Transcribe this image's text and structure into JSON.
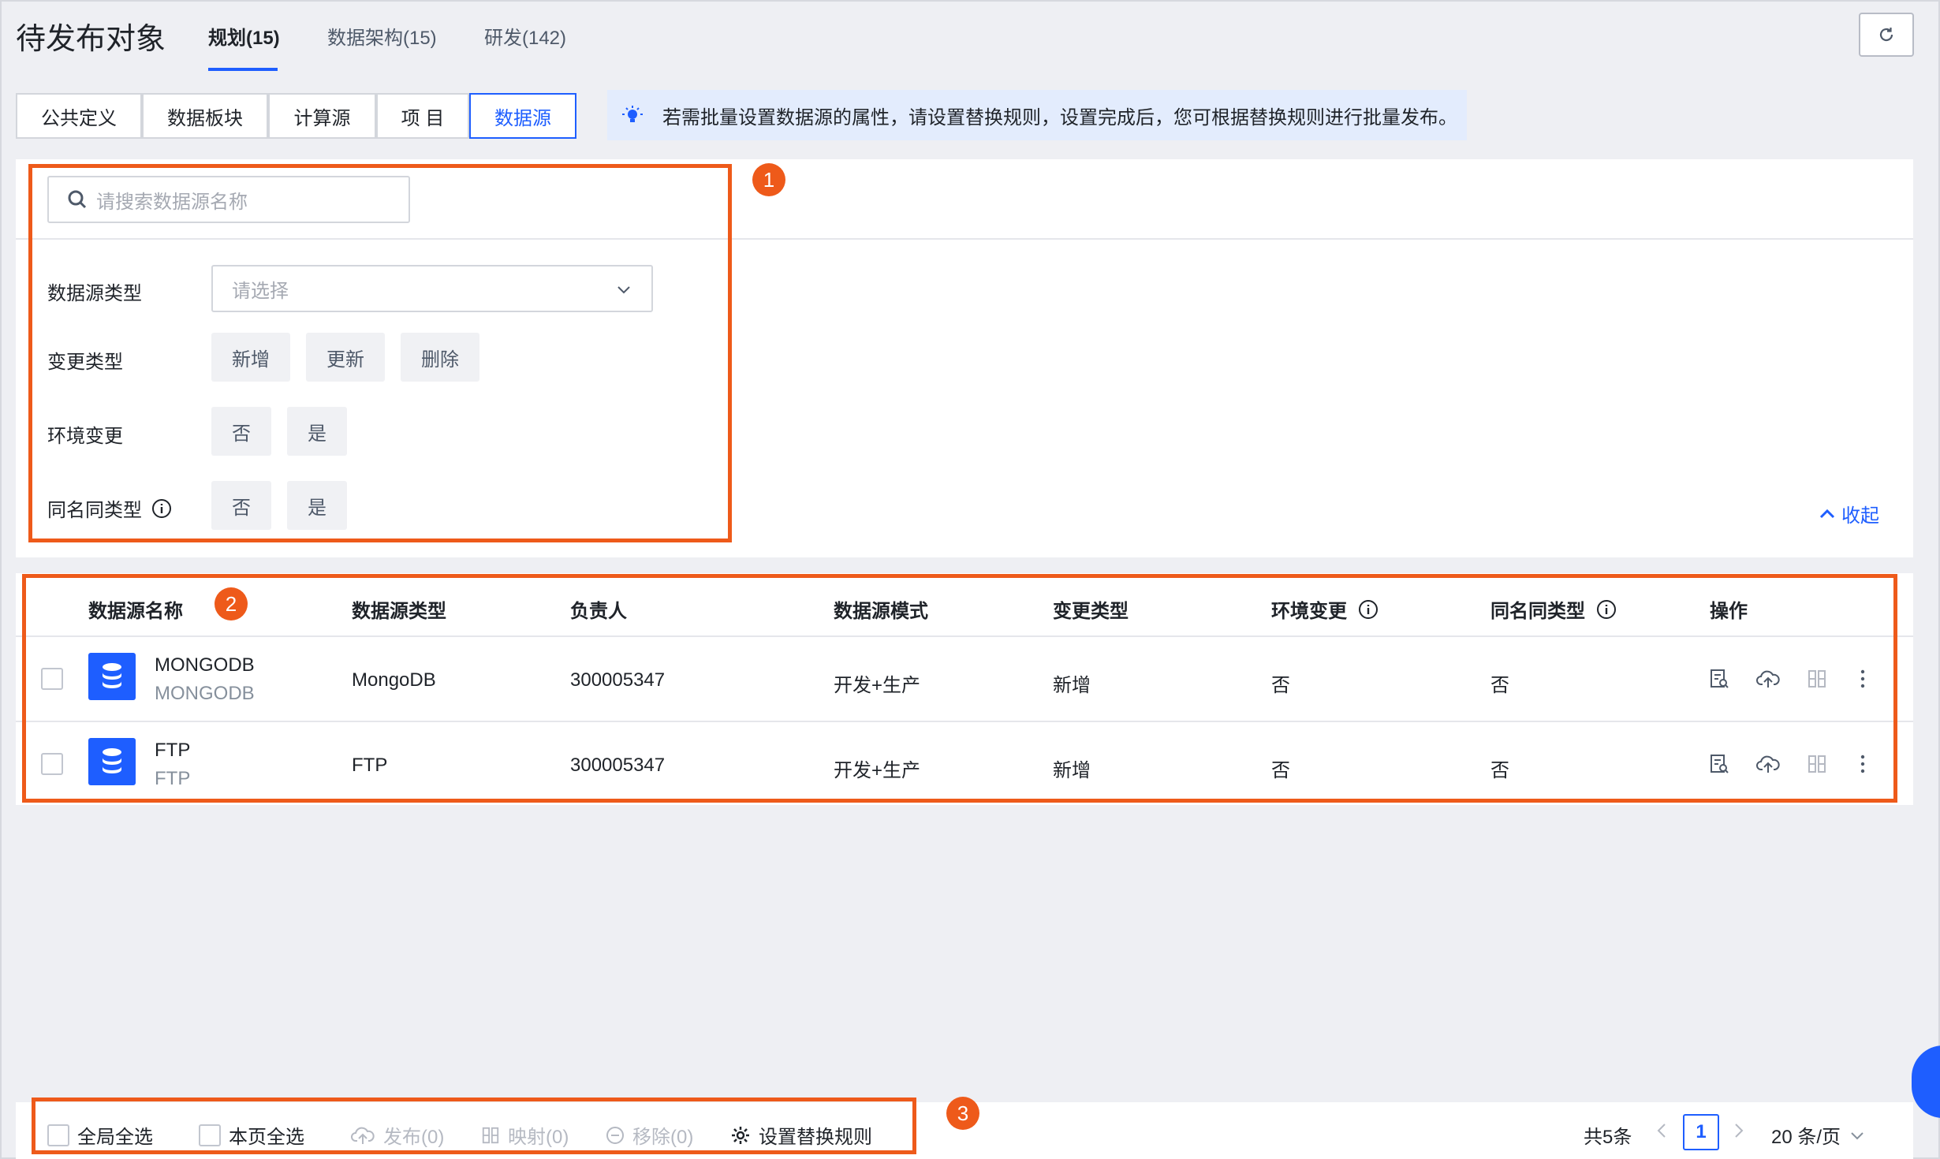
{
  "header": {
    "title": "待发布对象",
    "tabs": [
      {
        "label": "规划(15)",
        "active": true
      },
      {
        "label": "数据架构(15)",
        "active": false
      },
      {
        "label": "研发(142)",
        "active": false
      }
    ],
    "refresh_icon": "refresh-icon"
  },
  "subtabs": [
    {
      "label": "公共定义",
      "active": false
    },
    {
      "label": "数据板块",
      "active": false
    },
    {
      "label": "计算源",
      "active": false
    },
    {
      "label": "项 目",
      "active": false
    },
    {
      "label": "数据源",
      "active": true
    }
  ],
  "tip": {
    "icon": "lightbulb-icon",
    "text": "若需批量设置数据源的属性，请设置替换规则，设置完成后，您可根据替换规则进行批量发布。"
  },
  "filters": {
    "search_placeholder": "请搜索数据源名称",
    "type_label": "数据源类型",
    "type_placeholder": "请选择",
    "change_label": "变更类型",
    "change_options": [
      "新增",
      "更新",
      "删除"
    ],
    "env_label": "环境变更",
    "env_options": [
      "否",
      "是"
    ],
    "same_label": "同名同类型",
    "same_options": [
      "否",
      "是"
    ],
    "collapse_label": "收起"
  },
  "callouts": [
    "1",
    "2",
    "3"
  ],
  "table": {
    "columns": [
      "数据源名称",
      "数据源类型",
      "负责人",
      "数据源模式",
      "变更类型",
      "环境变更",
      "同名同类型",
      "操作"
    ],
    "rows": [
      {
        "name": "MONGODB",
        "sub": "MONGODB",
        "type": "MongoDB",
        "owner": "300005347",
        "mode": "开发+生产",
        "change": "新增",
        "env": "否",
        "same": "否"
      },
      {
        "name": "FTP",
        "sub": "FTP",
        "type": "FTP",
        "owner": "300005347",
        "mode": "开发+生产",
        "change": "新增",
        "env": "否",
        "same": "否"
      }
    ],
    "op_icons": [
      "detail-icon",
      "cloud-upload-icon",
      "mapping-icon",
      "more-icon"
    ]
  },
  "footer": {
    "select_all_global": "全局全选",
    "select_all_page": "本页全选",
    "publish": "发布(0)",
    "map": "映射(0)",
    "remove": "移除(0)",
    "rules": "设置替换规则",
    "total": "共5条",
    "current_page": "1",
    "page_size": "20 条/页"
  },
  "colors": {
    "accent": "#1e5eff",
    "callout": "#ee5a1a",
    "background": "#eeeff3"
  }
}
